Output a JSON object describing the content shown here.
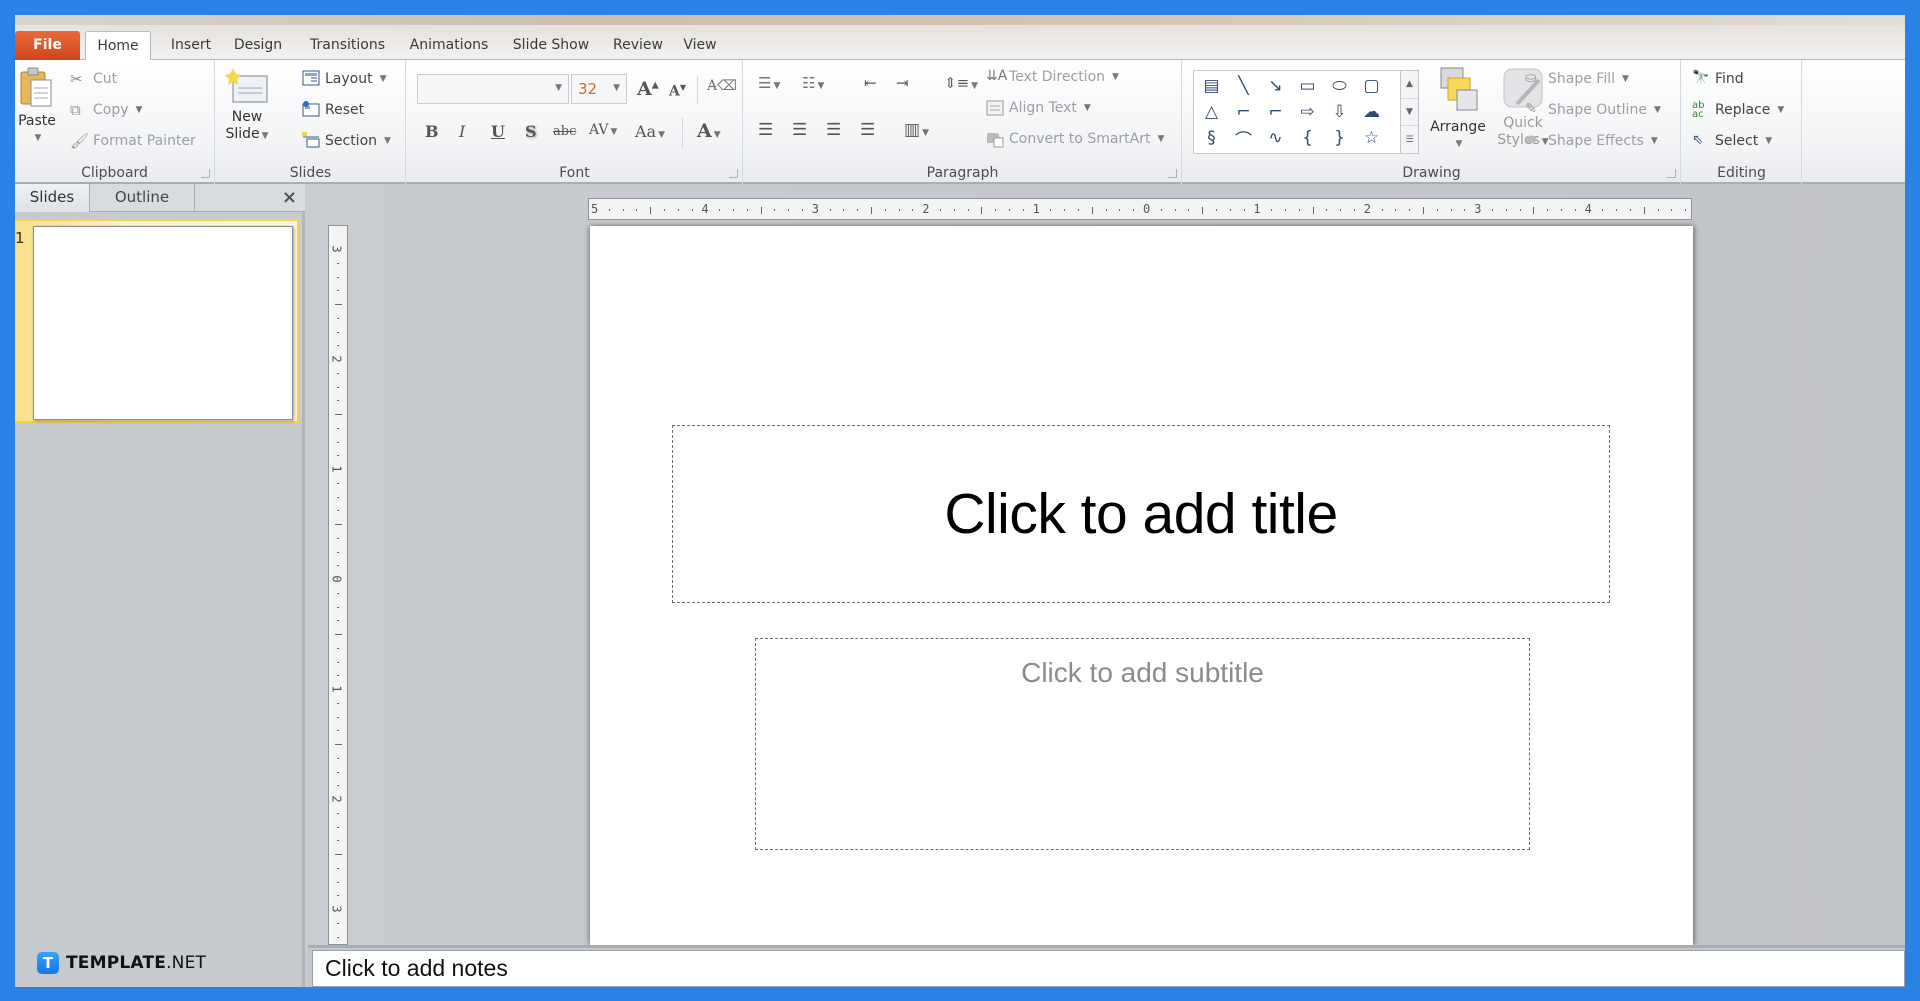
{
  "tabs": {
    "file": "File",
    "items": [
      "Home",
      "Insert",
      "Design",
      "Transitions",
      "Animations",
      "Slide Show",
      "Review",
      "View"
    ],
    "active": "Home"
  },
  "ribbon": {
    "clipboard": {
      "label": "Clipboard",
      "paste": "Paste",
      "cut": "Cut",
      "copy": "Copy",
      "format_painter": "Format Painter"
    },
    "slides": {
      "label": "Slides",
      "new_slide_line1": "New",
      "new_slide_line2": "Slide",
      "layout": "Layout",
      "reset": "Reset",
      "section": "Section"
    },
    "font": {
      "label": "Font",
      "font_name": "",
      "font_size": "32",
      "grow": "A",
      "shrink": "A",
      "bold": "B",
      "italic": "I",
      "underline": "U",
      "shadow": "S",
      "strikethrough": "abc",
      "spacing": "AV",
      "change_case": "Aa",
      "font_color": "A"
    },
    "paragraph": {
      "label": "Paragraph",
      "text_direction": "Text Direction",
      "align_text": "Align Text",
      "convert_smartart": "Convert to SmartArt"
    },
    "drawing": {
      "label": "Drawing",
      "shapes": [
        "▤",
        "╲",
        "↘",
        "▭",
        "⬭",
        "▢",
        "△",
        "⌐",
        "⌐",
        "⇨",
        "⇩",
        "☁",
        "§",
        "⌒",
        "∿",
        "{",
        "}",
        "☆"
      ],
      "arrange": "Arrange",
      "quick_styles_line1": "Quick",
      "quick_styles_line2": "Styles",
      "shape_fill": "Shape Fill",
      "shape_outline": "Shape Outline",
      "shape_effects": "Shape Effects"
    },
    "editing": {
      "label": "Editing",
      "find": "Find",
      "replace": "Replace",
      "select": "Select"
    }
  },
  "left_pane": {
    "tabs": [
      "Slides",
      "Outline"
    ],
    "active_tab": "Slides",
    "close": "×",
    "slide_number": "1"
  },
  "rulers": {
    "horizontal": [
      "5",
      "4",
      "3",
      "2",
      "1",
      "0",
      "1",
      "2",
      "3",
      "4"
    ],
    "vertical": [
      "3",
      "2",
      "1",
      "0",
      "1",
      "2",
      "3"
    ]
  },
  "slide": {
    "title_placeholder": "Click to add title",
    "subtitle_placeholder": "Click to add subtitle"
  },
  "notes": {
    "placeholder": "Click to add notes"
  },
  "watermark": {
    "icon": "T",
    "brand_bold": "TEMPLATE",
    "brand_light": ".NET"
  },
  "colors": {
    "frame": "#2b82e6",
    "file_tab": "#d9501f",
    "selection": "#f4cf5c"
  }
}
